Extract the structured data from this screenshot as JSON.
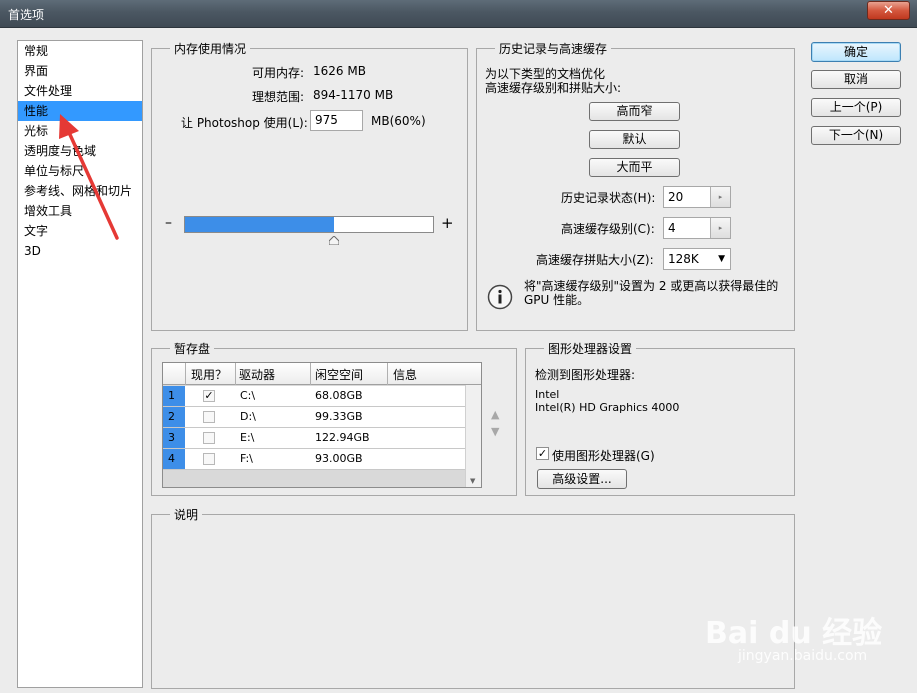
{
  "window": {
    "title": "首选项",
    "close_label": "✕"
  },
  "sidebar": {
    "items": [
      {
        "label": "常规"
      },
      {
        "label": "界面"
      },
      {
        "label": "文件处理"
      },
      {
        "label": "性能"
      },
      {
        "label": "光标"
      },
      {
        "label": "透明度与色域"
      },
      {
        "label": "单位与标尺"
      },
      {
        "label": "参考线、网格和切片"
      },
      {
        "label": "增效工具"
      },
      {
        "label": "文字"
      },
      {
        "label": "3D"
      }
    ],
    "selected_index": 3
  },
  "memory": {
    "legend": "内存使用情况",
    "available_label": "可用内存:",
    "available_value": "1626 MB",
    "ideal_label": "理想范围:",
    "ideal_value": "894-1170 MB",
    "use_label": "让 Photoshop 使用(L):",
    "use_value": "975",
    "use_suffix": "MB(60%)",
    "slider_percent": 60,
    "minus": "–",
    "plus": "+"
  },
  "history": {
    "legend": "历史记录与高速缓存",
    "desc_line1": "为以下类型的文档优化",
    "desc_line2": "高速缓存级别和拼贴大小:",
    "btn_tall": "高而窄",
    "btn_default": "默认",
    "btn_big": "大而平",
    "states_label": "历史记录状态(H):",
    "states_value": "20",
    "cache_label": "高速缓存级别(C):",
    "cache_value": "4",
    "tile_label": "高速缓存拼贴大小(Z):",
    "tile_value": "128K",
    "info_line1": "将\"高速缓存级别\"设置为 2 或更高以获得最佳的",
    "info_line2": "GPU 性能。"
  },
  "scratch": {
    "legend": "暂存盘",
    "headers": {
      "active": "现用？",
      "drive": "驱动器",
      "free": "闲空空间",
      "info": "信息"
    },
    "rows": [
      {
        "num": "1",
        "checked": "✓",
        "drive": "C:\\",
        "free": "68.08GB"
      },
      {
        "num": "2",
        "checked": "",
        "drive": "D:\\",
        "free": "99.33GB"
      },
      {
        "num": "3",
        "checked": "",
        "drive": "E:\\",
        "free": "122.94GB"
      },
      {
        "num": "4",
        "checked": "",
        "drive": "F:\\",
        "free": "93.00GB"
      }
    ],
    "up_arrow": "▲",
    "down_arrow": "▼"
  },
  "gpu": {
    "legend": "图形处理器设置",
    "detected_label": "检测到图形处理器:",
    "vendor": "Intel",
    "model": "Intel(R) HD Graphics 4000",
    "use_gpu_label": "使用图形处理器(G)",
    "use_gpu_checked": "✓",
    "advanced_btn": "高级设置..."
  },
  "description": {
    "legend": "说明"
  },
  "buttons": {
    "ok": "确定",
    "cancel": "取消",
    "prev": "上一个(P)",
    "next": "下一个(N)"
  },
  "watermark": {
    "line1": "Bai du 经验",
    "line2": "jingyan.baidu.com"
  },
  "colors": {
    "selection": "#3399ff",
    "slider_fill": "#3d8ee8",
    "annotation_arrow": "#e53935"
  }
}
